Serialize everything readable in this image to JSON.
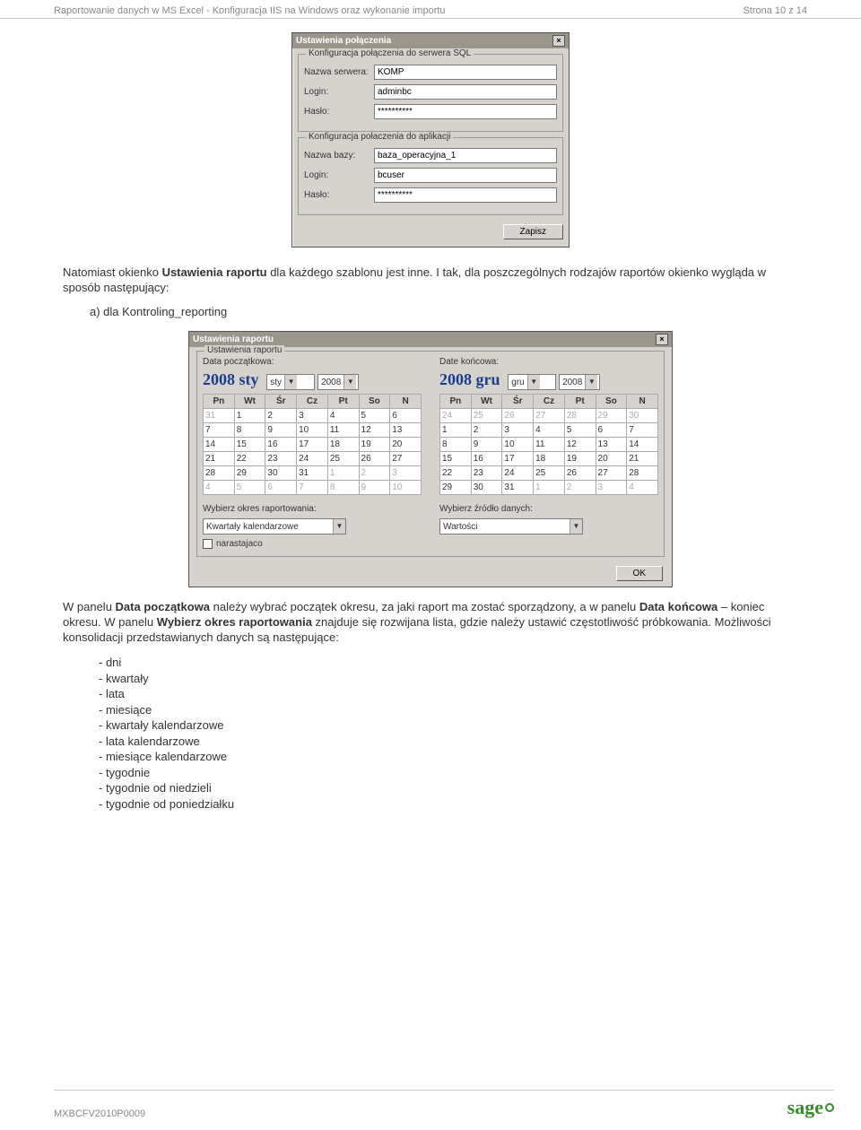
{
  "header": {
    "title": "Raportowanie danych w MS Excel - Konfiguracja IIS na Windows oraz wykonanie importu",
    "page_info": "Strona 10 z 14"
  },
  "dialog1": {
    "title": "Ustawienia połączenia",
    "group_sql": {
      "title": "Konfiguracja połączenia do serwera SQL",
      "server_label": "Nazwa serwera:",
      "server_value": "KOMP",
      "login_label": "Login:",
      "login_value": "adminbc",
      "password_label": "Hasło:",
      "password_value": "**********"
    },
    "group_app": {
      "title": "Konfiguracja połaczenia do aplikacji",
      "db_label": "Nazwa bazy:",
      "db_value": "baza_operacyjna_1",
      "login_label": "Login:",
      "login_value": "bcuser",
      "password_label": "Hasło:",
      "password_value": "**********"
    },
    "save_button": "Zapisz"
  },
  "para1_pre": "Natomiast okienko ",
  "para1_b1": "Ustawienia raportu",
  "para1_mid": " dla każdego szablonu jest inne. I tak, dla poszczególnych rodzajów raportów okienko wygląda w sposób następujący:",
  "list_a": "a)   dla Kontroling_reporting",
  "dialog2": {
    "title": "Ustawienia raportu",
    "group_title": "Ustawienia raportu",
    "start_label": "Data początkowa:",
    "end_label": "Date końcowa:",
    "start_display": "2008  sty",
    "end_display": "2008  gru",
    "month_combo_start": "sty",
    "year_combo_start": "2008",
    "month_combo_end": "gru",
    "year_combo_end": "2008",
    "days": [
      "Pn",
      "Wt",
      "Śr",
      "Cz",
      "Pt",
      "So",
      "N"
    ],
    "cal_start": [
      [
        {
          "v": "31",
          "dim": true
        },
        {
          "v": "1"
        },
        {
          "v": "2"
        },
        {
          "v": "3"
        },
        {
          "v": "4"
        },
        {
          "v": "5"
        },
        {
          "v": "6"
        }
      ],
      [
        {
          "v": "7"
        },
        {
          "v": "8"
        },
        {
          "v": "9"
        },
        {
          "v": "10"
        },
        {
          "v": "11"
        },
        {
          "v": "12"
        },
        {
          "v": "13"
        }
      ],
      [
        {
          "v": "14"
        },
        {
          "v": "15"
        },
        {
          "v": "16"
        },
        {
          "v": "17"
        },
        {
          "v": "18"
        },
        {
          "v": "19"
        },
        {
          "v": "20"
        }
      ],
      [
        {
          "v": "21"
        },
        {
          "v": "22"
        },
        {
          "v": "23"
        },
        {
          "v": "24"
        },
        {
          "v": "25"
        },
        {
          "v": "26"
        },
        {
          "v": "27"
        }
      ],
      [
        {
          "v": "28"
        },
        {
          "v": "29"
        },
        {
          "v": "30"
        },
        {
          "v": "31"
        },
        {
          "v": "1",
          "dim": true
        },
        {
          "v": "2",
          "dim": true
        },
        {
          "v": "3",
          "dim": true
        }
      ],
      [
        {
          "v": "4",
          "dim": true
        },
        {
          "v": "5",
          "dim": true
        },
        {
          "v": "6",
          "dim": true
        },
        {
          "v": "7",
          "dim": true
        },
        {
          "v": "8",
          "dim": true
        },
        {
          "v": "9",
          "dim": true
        },
        {
          "v": "10",
          "dim": true
        }
      ]
    ],
    "cal_end": [
      [
        {
          "v": "24",
          "dim": true
        },
        {
          "v": "25",
          "dim": true
        },
        {
          "v": "26",
          "dim": true
        },
        {
          "v": "27",
          "dim": true
        },
        {
          "v": "28",
          "dim": true
        },
        {
          "v": "29",
          "dim": true
        },
        {
          "v": "30",
          "dim": true
        }
      ],
      [
        {
          "v": "1"
        },
        {
          "v": "2"
        },
        {
          "v": "3"
        },
        {
          "v": "4"
        },
        {
          "v": "5"
        },
        {
          "v": "6"
        },
        {
          "v": "7"
        }
      ],
      [
        {
          "v": "8"
        },
        {
          "v": "9"
        },
        {
          "v": "10"
        },
        {
          "v": "11"
        },
        {
          "v": "12"
        },
        {
          "v": "13"
        },
        {
          "v": "14"
        }
      ],
      [
        {
          "v": "15"
        },
        {
          "v": "16"
        },
        {
          "v": "17"
        },
        {
          "v": "18"
        },
        {
          "v": "19"
        },
        {
          "v": "20"
        },
        {
          "v": "21"
        }
      ],
      [
        {
          "v": "22"
        },
        {
          "v": "23"
        },
        {
          "v": "24"
        },
        {
          "v": "25"
        },
        {
          "v": "26"
        },
        {
          "v": "27"
        },
        {
          "v": "28"
        }
      ],
      [
        {
          "v": "29"
        },
        {
          "v": "30"
        },
        {
          "v": "31"
        },
        {
          "v": "1",
          "dim": true
        },
        {
          "v": "2",
          "dim": true
        },
        {
          "v": "3",
          "dim": true
        },
        {
          "v": "4",
          "dim": true
        }
      ]
    ],
    "period_label": "Wybierz okres raportowania:",
    "period_value": "Kwartały kalendarzowe",
    "narastajaco": "narastajaco",
    "source_label": "Wybierz źródło danych:",
    "source_value": "Wartości",
    "ok_button": "OK"
  },
  "para2_a": "W panelu ",
  "para2_b1": "Data początkowa",
  "para2_c": " należy wybrać początek okresu, za jaki raport ma zostać sporządzony, a w panelu ",
  "para2_b2": "Data końcowa",
  "para2_d": " – koniec okresu. W panelu ",
  "para2_b3": "Wybierz okres raportowania",
  "para2_e": " znajduje się rozwijana lista, gdzie należy ustawić częstotliwość próbkowania. Możliwości konsolidacji przedstawianych danych są następujące:",
  "bullets": [
    "- dni",
    "- kwartały",
    "- lata",
    "- miesiące",
    "- kwartały kalendarzowe",
    "- lata kalendarzowe",
    "- miesiące kalendarzowe",
    "- tygodnie",
    "- tygodnie od niedzieli",
    "- tygodnie od poniedziałku"
  ],
  "footer": {
    "code": "MXBCFV2010P0009",
    "logo": "sage"
  }
}
